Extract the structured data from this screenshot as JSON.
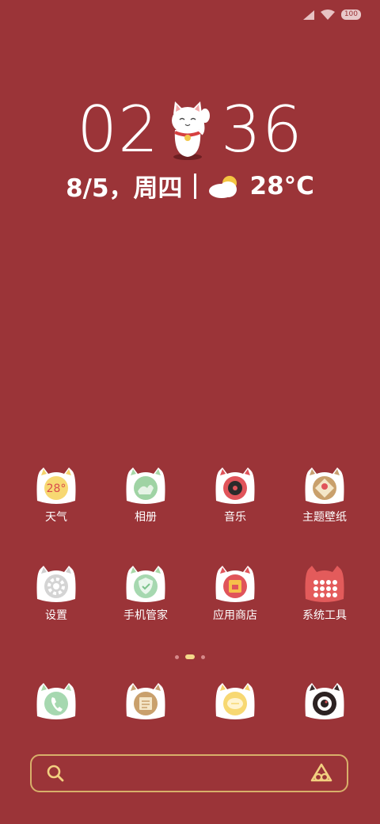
{
  "status_bar": {
    "battery": "100"
  },
  "clock": {
    "hour": "02",
    "minute": "36"
  },
  "date": {
    "text": "8/5，周四",
    "temperature": "28°C"
  },
  "apps": [
    {
      "label": "天气",
      "icon": "weather-icon"
    },
    {
      "label": "相册",
      "icon": "gallery-icon"
    },
    {
      "label": "音乐",
      "icon": "music-icon"
    },
    {
      "label": "主题壁纸",
      "icon": "themes-icon"
    },
    {
      "label": "设置",
      "icon": "settings-icon"
    },
    {
      "label": "手机管家",
      "icon": "security-icon"
    },
    {
      "label": "应用商店",
      "icon": "app-store-icon"
    },
    {
      "label": "系统工具",
      "icon": "tools-icon"
    }
  ],
  "weather_widget_temp": "28°",
  "dock": [
    {
      "icon": "phone-icon"
    },
    {
      "icon": "notes-icon"
    },
    {
      "icon": "messages-icon"
    },
    {
      "icon": "camera-icon"
    }
  ],
  "pages": {
    "count": 3,
    "active": 2
  },
  "search": {
    "placeholder": ""
  },
  "colors": {
    "background": "#9b3438",
    "accent": "#d8b06a"
  }
}
